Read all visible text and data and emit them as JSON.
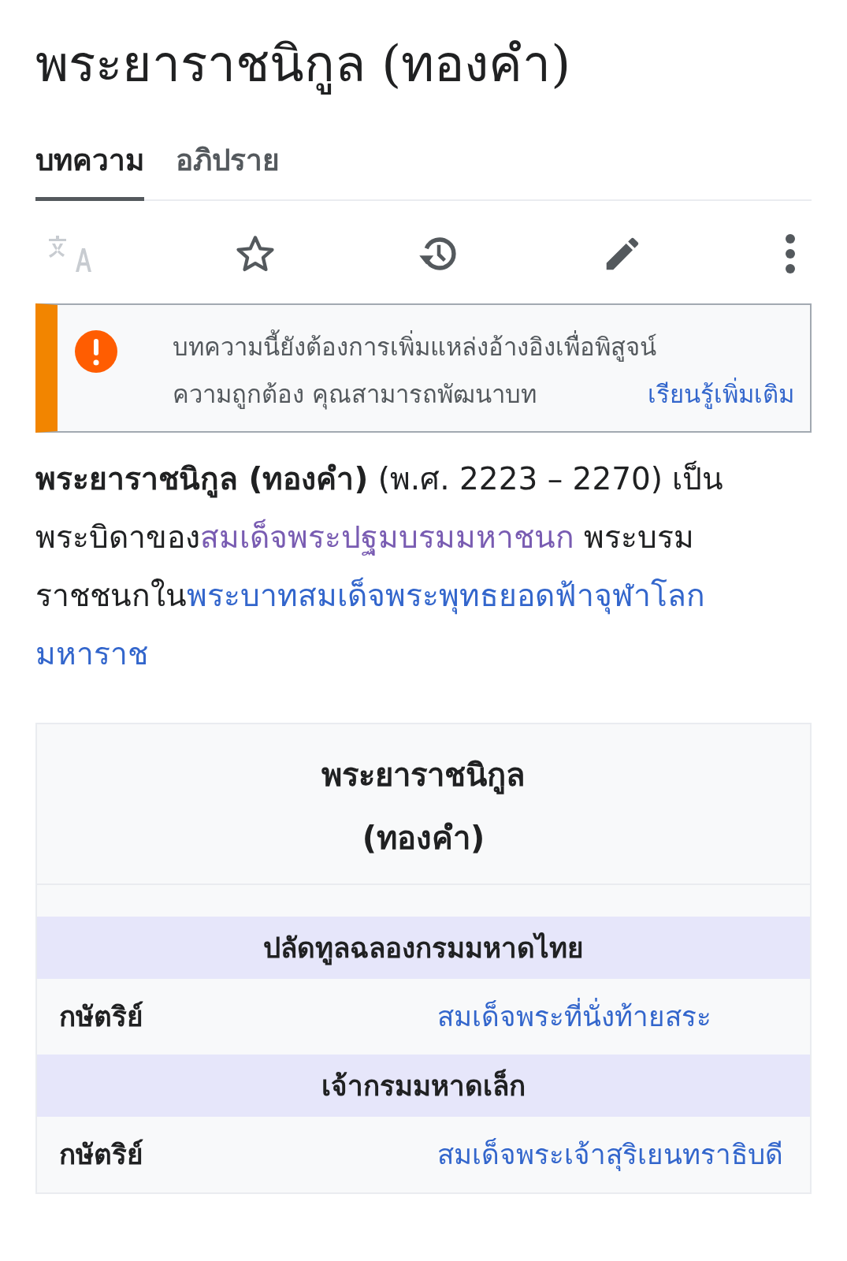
{
  "title": "พระยาราชนิกูล (ทองคำ)",
  "tabs": [
    {
      "label": "บทความ",
      "selected": true
    },
    {
      "label": "อภิปราย",
      "selected": false
    }
  ],
  "toolbar": [
    {
      "kind": "language",
      "disabled": true
    },
    {
      "kind": "watch",
      "disabled": false
    },
    {
      "kind": "history",
      "disabled": false
    },
    {
      "kind": "edit",
      "disabled": false
    },
    {
      "kind": "more",
      "disabled": false
    }
  ],
  "notice": {
    "lines": [
      "บทความนี้ยังต้องการเพิ่มแหล่งอ้างอิงเพื่อพิสูจน์",
      "ความถูกต้อง คุณสามารถพัฒนาบท"
    ],
    "link": "เรียนรู้เพิ่มเติม"
  },
  "lead": [
    {
      "kind": "bold",
      "text": "พระยาราชนิกูล (ทองคำ)"
    },
    {
      "kind": "plain",
      "text": " (พ.ศ. 2223 – 2270) เป็น"
    },
    {
      "kind": "plain",
      "text": "พระบิดาของ"
    },
    {
      "kind": "visited",
      "text": "สมเด็จพระปฐมบรมมหาชนก"
    },
    {
      "kind": "plain",
      "text": " พระบรม"
    },
    {
      "kind": "plain",
      "text": "ราชชนกใน"
    },
    {
      "kind": "link",
      "text": "พระบาทสมเด็จพระพุทธยอดฟ้าจุฬาโลก"
    },
    {
      "kind": "link",
      "text": "มหาราช"
    }
  ],
  "infobox": {
    "title_lines": [
      "พระยาราชนิกูล",
      "(ทองคำ)"
    ],
    "rows": [
      {
        "kind": "header",
        "text": "ปลัดทูลฉลองกรมมหาดไทย"
      },
      {
        "kind": "data",
        "label": "กษัตริย์",
        "value": "สมเด็จพระที่นั่งท้ายสระ"
      },
      {
        "kind": "header",
        "text": "เจ้ากรมมหาดเล็ก"
      },
      {
        "kind": "data",
        "label": "กษัตริย์",
        "value": "สมเด็จพระเจ้าสุริเยนทราธิบดี"
      }
    ]
  }
}
